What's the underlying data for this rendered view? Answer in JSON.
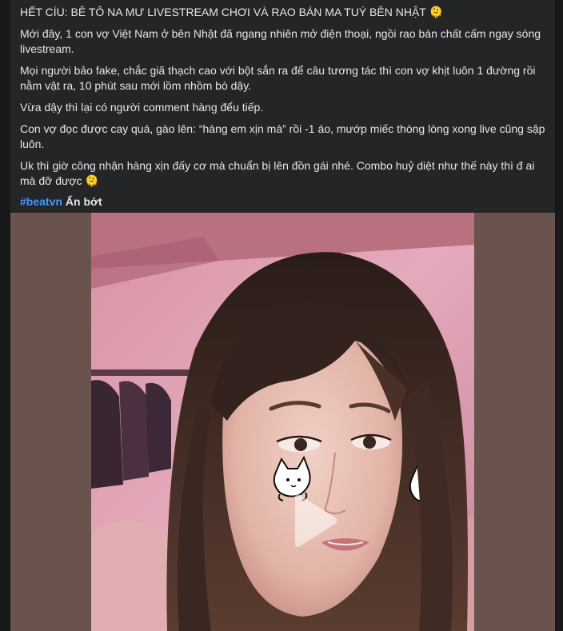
{
  "post": {
    "headline": "HẾT CÍU: BÊ TÔ NA MƯ LIVESTREAM CHƠI VÀ RAO BÁN MA TUÝ BÊN NHẬT 🫠",
    "paragraphs": [
      "Mới đây, 1 con vợ Việt Nam ở bên Nhật đã ngang nhiên mở điện thoại, ngồi rao bán chất cấm ngay sóng livestream.",
      "Mọi người bảo fake, chắc giã thạch cao với bột sắn ra để câu tương tác thì con vợ khịt luôn 1 đường rồi nằm vật ra, 10 phút sau mới lồm nhồm bò dậy.",
      "Vừa dậy thì lại có người comment hàng đểu tiếp.",
      "Con vợ đọc được cay quá, gào lên: “hàng em xịn mà” rồi -1 áo, mướp miếc thòng lòng xong live cũng sập luôn.",
      "Uk thì giờ công nhận hàng xịn đấy cơ mà chuẩn bị lên đồn gái nhé. Combo huỷ diệt như thế này thì đ ai mà đỡ được 🫠"
    ],
    "hashtag": "#beatvn",
    "see_less_label": "Ẩn bớt"
  },
  "video": {
    "thumbnail_subject": "livestream-still-woman-with-cat-stickers",
    "play_icon": "play-icon",
    "colors": {
      "pillarbox": "#6a524d",
      "backdrop_pink": "#e2a5b6",
      "skin": "#e8c4b8",
      "hair": "#3a2822"
    }
  }
}
